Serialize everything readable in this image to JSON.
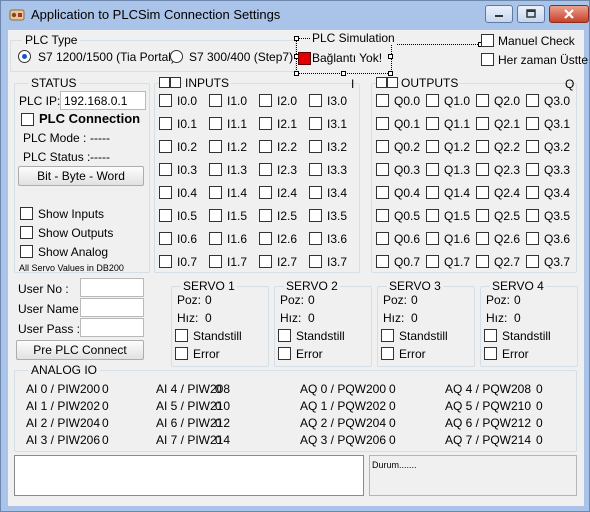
{
  "window": {
    "title": "Application to PLCSim Connection Settings"
  },
  "plc_type": {
    "legend": "PLC Type",
    "options": [
      "S7 1200/1500 (Tia Portal)",
      "S7 300/400 (Step7)"
    ]
  },
  "plc_sim": {
    "legend": "PLC Simulation",
    "status": "Bağlantı Yok!",
    "status_color": "#e10000"
  },
  "top_checks": {
    "manual": "Manuel Check",
    "always_top": "Her zaman Üstte"
  },
  "status": {
    "legend": "STATUS",
    "ip_label": "PLC IP:",
    "ip_value": "192.168.0.1",
    "connection": "PLC Connection",
    "mode_label": "PLC Mode :",
    "mode_value": "-----",
    "status_label": "PLC Status :",
    "status_value": "-----",
    "bbw_button": "Bit - Byte - Word",
    "show_inputs": "Show Inputs",
    "show_outputs": "Show Outputs",
    "show_analog": "Show Analog",
    "note": "All Servo Values in DB200"
  },
  "inputs": {
    "legend": "INPUTS",
    "right": "I",
    "columns": [
      [
        "I0.0",
        "I0.1",
        "I0.2",
        "I0.3",
        "I0.4",
        "I0.5",
        "I0.6",
        "I0.7"
      ],
      [
        "I1.0",
        "I1.1",
        "I1.2",
        "I1.3",
        "I1.4",
        "I1.5",
        "I1.6",
        "I1.7"
      ],
      [
        "I2.0",
        "I2.1",
        "I2.2",
        "I2.3",
        "I2.4",
        "I2.5",
        "I2.6",
        "I2.7"
      ],
      [
        "I3.0",
        "I3.1",
        "I3.2",
        "I3.3",
        "I3.4",
        "I3.5",
        "I3.6",
        "I3.7"
      ]
    ]
  },
  "outputs": {
    "legend": "OUTPUTS",
    "right": "Q",
    "columns": [
      [
        "Q0.0",
        "Q0.1",
        "Q0.2",
        "Q0.3",
        "Q0.4",
        "Q0.5",
        "Q0.6",
        "Q0.7"
      ],
      [
        "Q1.0",
        "Q1.1",
        "Q1.2",
        "Q1.3",
        "Q1.4",
        "Q1.5",
        "Q1.6",
        "Q1.7"
      ],
      [
        "Q2.0",
        "Q2.1",
        "Q2.2",
        "Q2.3",
        "Q2.4",
        "Q2.5",
        "Q2.6",
        "Q2.7"
      ],
      [
        "Q3.0",
        "Q3.1",
        "Q3.2",
        "Q3.3",
        "Q3.4",
        "Q3.5",
        "Q3.6",
        "Q3.7"
      ]
    ]
  },
  "login": {
    "user_no": "User No :",
    "user_name": "User Name :",
    "user_pass": "User Pass :",
    "connect": "Pre PLC Connect"
  },
  "servos": [
    {
      "title": "SERVO 1",
      "poz_label": "Poz:",
      "poz": "0",
      "hiz_label": "Hız:",
      "hiz": "0",
      "standstill": "Standstill",
      "error": "Error"
    },
    {
      "title": "SERVO 2",
      "poz_label": "Poz:",
      "poz": "0",
      "hiz_label": "Hız:",
      "hiz": "0",
      "standstill": "Standstill",
      "error": "Error"
    },
    {
      "title": "SERVO 3",
      "poz_label": "Poz:",
      "poz": "0",
      "hiz_label": "Hız:",
      "hiz": "0",
      "standstill": "Standstill",
      "error": "Error"
    },
    {
      "title": "SERVO 4",
      "poz_label": "Poz:",
      "poz": "0",
      "hiz_label": "Hız:",
      "hiz": "0",
      "standstill": "Standstill",
      "error": "Error"
    }
  ],
  "analog": {
    "legend": "ANALOG  IO",
    "columns": [
      [
        {
          "label": "AI 0 / PIW200",
          "value": "0"
        },
        {
          "label": "AI 1 / PIW202",
          "value": "0"
        },
        {
          "label": "AI 2 / PIW204",
          "value": "0"
        },
        {
          "label": "AI 3 / PIW206",
          "value": "0"
        }
      ],
      [
        {
          "label": "AI 4 / PIW208",
          "value": "0"
        },
        {
          "label": "AI 5 / PIW210",
          "value": "0"
        },
        {
          "label": "AI 6 / PIW212",
          "value": "0"
        },
        {
          "label": "AI 7 / PIW214",
          "value": "0"
        }
      ],
      [
        {
          "label": "AQ 0 / PQW200",
          "value": "0"
        },
        {
          "label": "AQ 1 / PQW202",
          "value": "0"
        },
        {
          "label": "AQ 2 / PQW204",
          "value": "0"
        },
        {
          "label": "AQ 3 / PQW206",
          "value": "0"
        }
      ],
      [
        {
          "label": "AQ 4 / PQW208",
          "value": "0"
        },
        {
          "label": "AQ 5 / PQW210",
          "value": "0"
        },
        {
          "label": "AQ 6 / PQW212",
          "value": "0"
        },
        {
          "label": "AQ 7 / PQW214",
          "value": "0"
        }
      ]
    ]
  },
  "durum": "Durum......."
}
